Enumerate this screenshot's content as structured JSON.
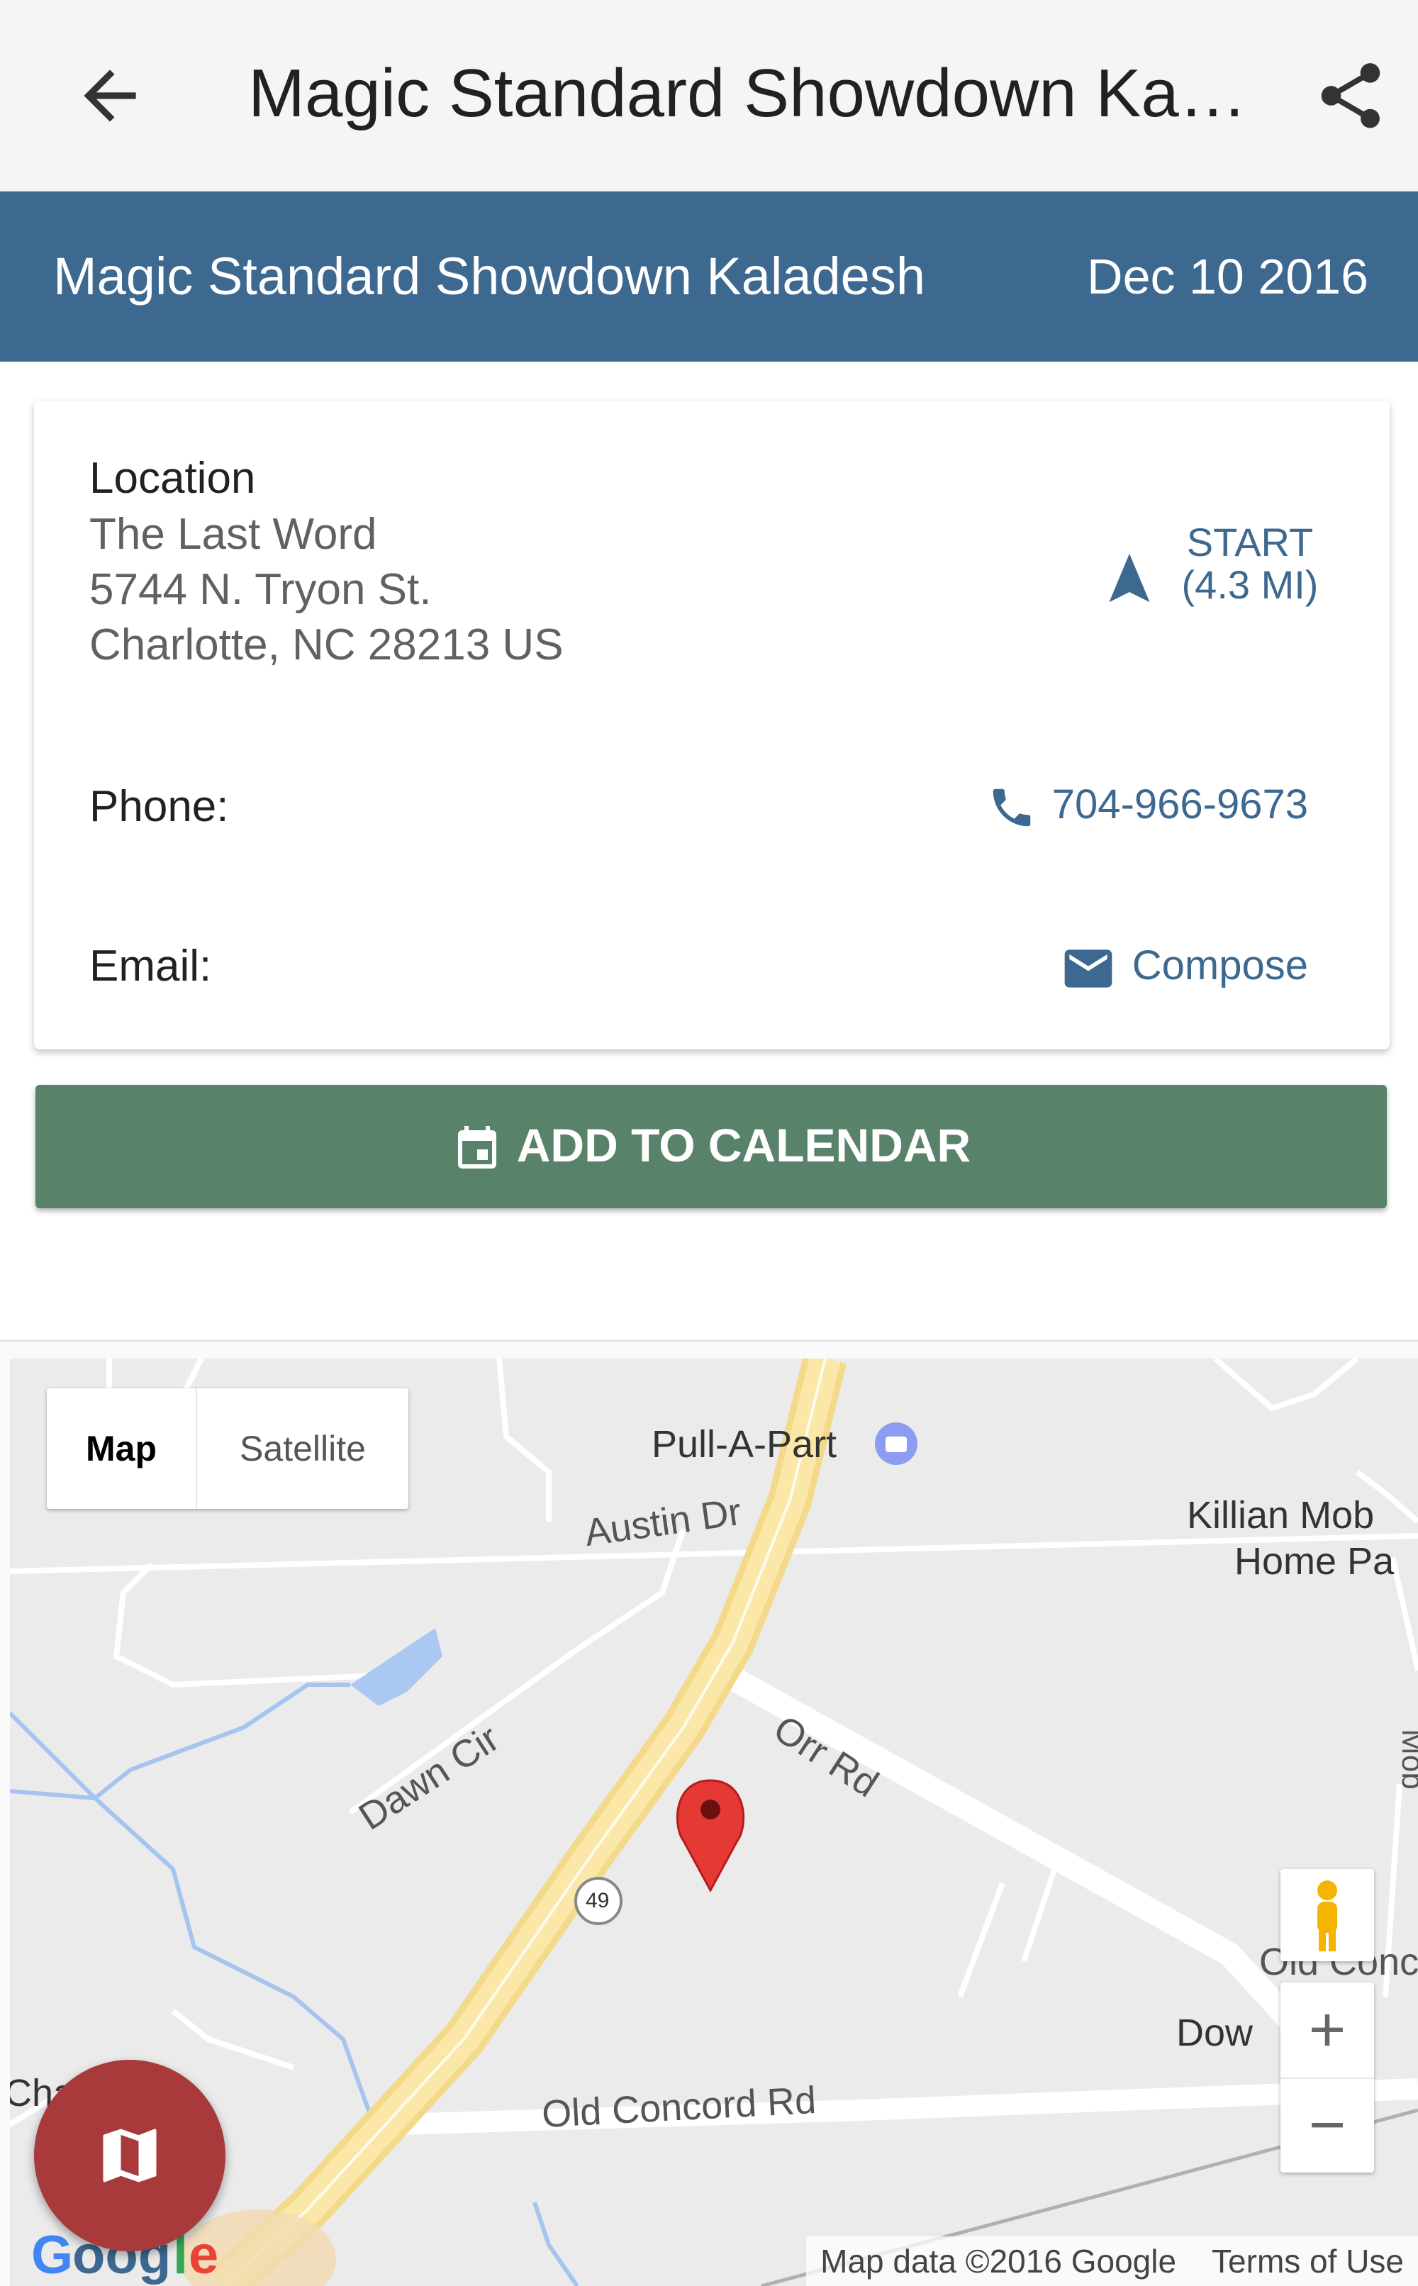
{
  "appbar": {
    "title": "Magic Standard Showdown Kaladesh"
  },
  "event": {
    "name": "Magic Standard Showdown Kaladesh",
    "date": "Dec 10 2016"
  },
  "card": {
    "location_label": "Location",
    "address_line1": "The Last Word",
    "address_line2": "5744 N. Tryon St.",
    "address_line3": "Charlotte, NC 28213 US",
    "start_label": "START",
    "start_distance": "(4.3 MI)",
    "phone_label": "Phone:",
    "phone_number": "704-966-9673",
    "email_label": "Email:",
    "email_action": "Compose"
  },
  "calendar_button": {
    "label": "ADD TO CALENDAR"
  },
  "map": {
    "toggle_map": "Map",
    "toggle_satellite": "Satellite",
    "labels": {
      "pull_a_part": "Pull-A-Part",
      "austin_dr": "Austin Dr",
      "killian_1": "Killian Mob",
      "killian_2": "Home Pa",
      "dawn_cir": "Dawn Cir",
      "orr_rd": "Orr Rd",
      "route_49": "49",
      "old_concord_rd": "Old Concord Rd",
      "old_conc_partial": "Old Conc",
      "dow_partial": "Dow",
      "cha_partial": "Cha",
      "mob_partial": "Mob"
    },
    "zoom_in": "+",
    "zoom_out": "−",
    "attribution": "Map data ©2016 Google",
    "terms": "Terms of Use",
    "logo": "Google"
  },
  "colors": {
    "banner": "#3d6890",
    "accent": "#3d6890",
    "calendar_button": "#58836a",
    "fab": "#a83a3c"
  },
  "icons": {
    "back": "arrow-back-icon",
    "share": "share-icon",
    "navigate": "navigation-arrow-icon",
    "phone": "phone-icon",
    "email": "mail-icon",
    "calendar": "calendar-icon",
    "map_fab": "map-icon",
    "pegman": "street-view-icon",
    "marker": "map-marker-icon"
  }
}
